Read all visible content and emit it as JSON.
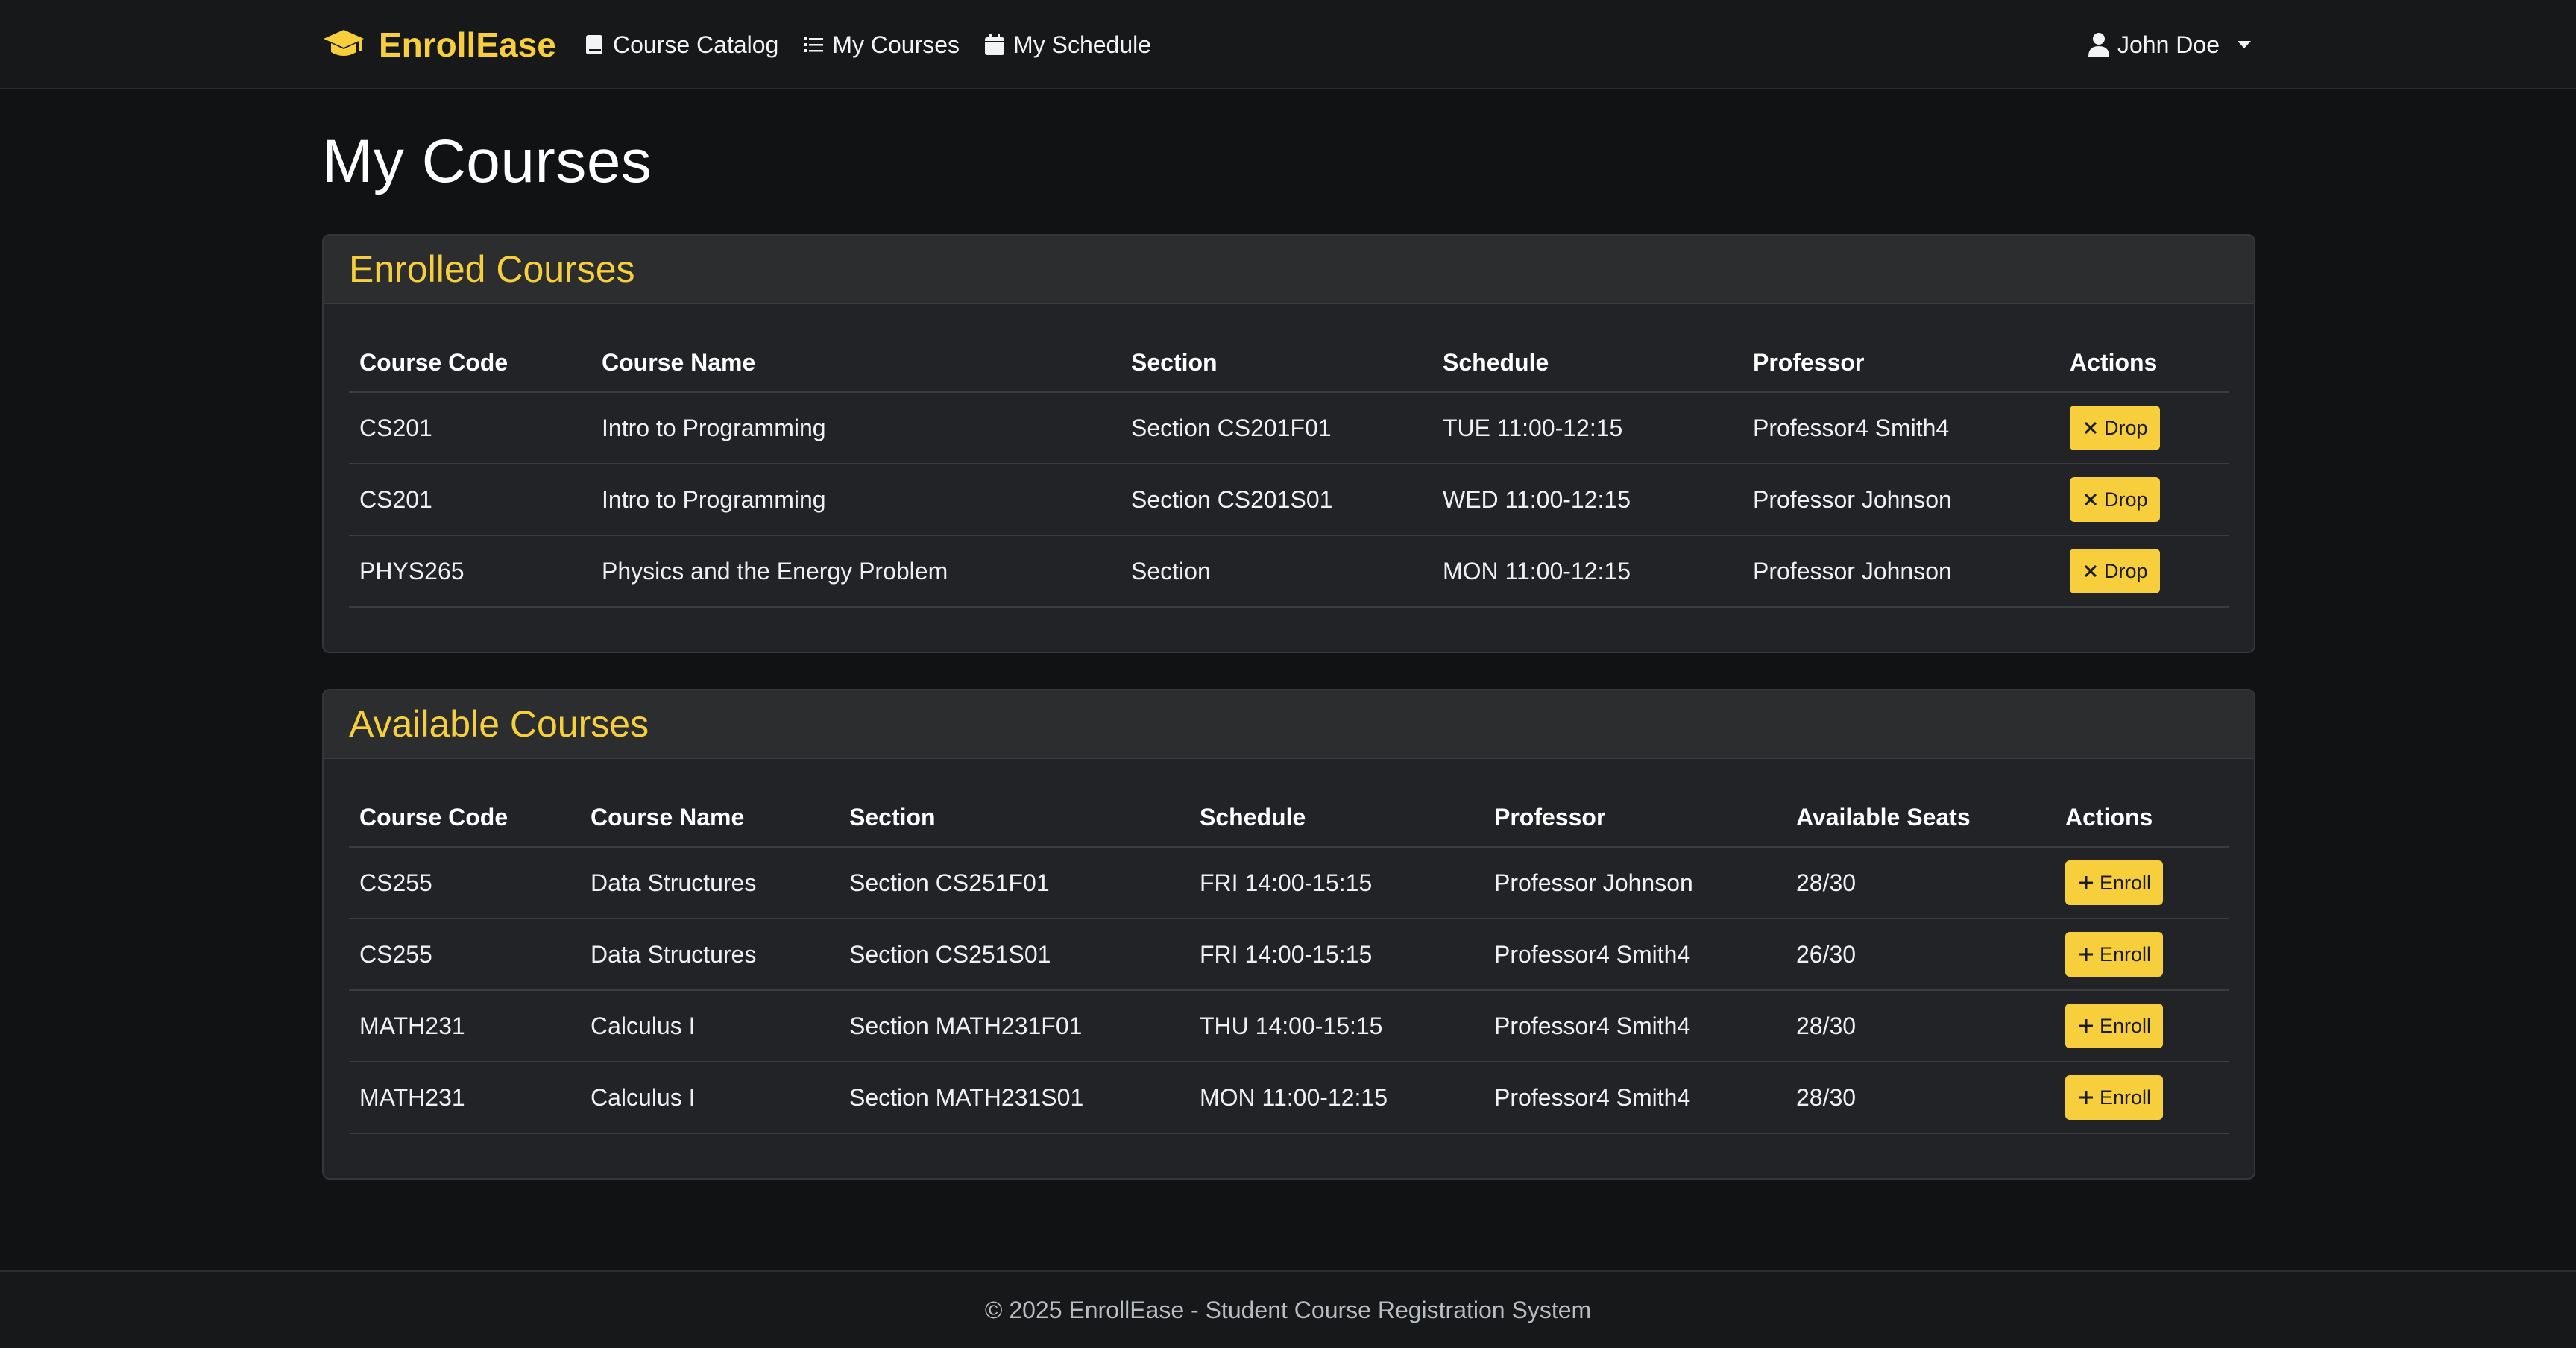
{
  "app": {
    "brand": "EnrollEase",
    "nav": [
      "Course Catalog",
      "My Courses",
      "My Schedule"
    ],
    "user": "John Doe"
  },
  "page_title": "My Courses",
  "enrolled": {
    "title": "Enrolled Courses",
    "headers": [
      "Course Code",
      "Course Name",
      "Section",
      "Schedule",
      "Professor",
      "Actions"
    ],
    "action_label": "Drop",
    "rows": [
      [
        "CS201",
        "Intro to Programming",
        "Section CS201F01",
        "TUE 11:00-12:15",
        "Professor4 Smith4"
      ],
      [
        "CS201",
        "Intro to Programming",
        "Section CS201S01",
        "WED 11:00-12:15",
        "Professor Johnson"
      ],
      [
        "PHYS265",
        "Physics and the Energy Problem",
        "Section",
        "MON 11:00-12:15",
        "Professor Johnson"
      ]
    ]
  },
  "available": {
    "title": "Available Courses",
    "headers": [
      "Course Code",
      "Course Name",
      "Section",
      "Schedule",
      "Professor",
      "Available Seats",
      "Actions"
    ],
    "action_label": "Enroll",
    "rows": [
      [
        "CS255",
        "Data Structures",
        "Section CS251F01",
        "FRI 14:00-15:15",
        "Professor Johnson",
        "28/30"
      ],
      [
        "CS255",
        "Data Structures",
        "Section CS251S01",
        "FRI 14:00-15:15",
        "Professor4 Smith4",
        "26/30"
      ],
      [
        "MATH231",
        "Calculus I",
        "Section MATH231F01",
        "THU 14:00-15:15",
        "Professor4 Smith4",
        "28/30"
      ],
      [
        "MATH231",
        "Calculus I",
        "Section MATH231S01",
        "MON 11:00-12:15",
        "Professor4 Smith4",
        "28/30"
      ]
    ]
  },
  "footer": "© 2025 EnrollEase - Student Course Registration System",
  "colors": {
    "accent": "#f7cf3c",
    "background": "#111213",
    "card": "#212326"
  },
  "icons": [
    "graduation-cap-icon",
    "book-icon",
    "list-icon",
    "calendar-icon",
    "person-icon",
    "x-icon",
    "plus-icon"
  ]
}
